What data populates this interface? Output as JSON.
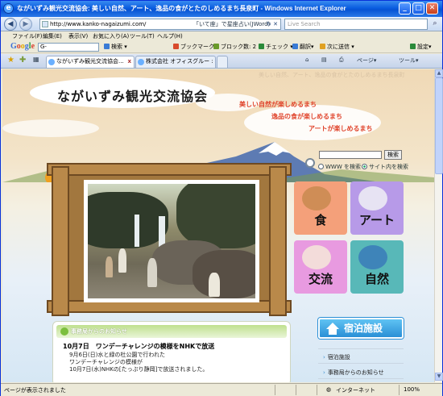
{
  "window": {
    "title": "ながいずみ観光交流協会: 美しい自然、アート、逸品の食がとたのしめるまち長泉町 - Windows Internet Explorer",
    "minimize": "_",
    "maximize": "□",
    "close": "✕"
  },
  "address": {
    "url": "http://www.kanko-nagaizumi.com/",
    "nav_hint": "↻ ✕",
    "search_placeholder": "Live Search",
    "highlight_text": "「いて座」で星座占い(JWord)"
  },
  "menu": [
    "ファイル(F)",
    "編集(E)",
    "表示(V)",
    "お気に入り(A)",
    "ツール(T)",
    "ヘルプ(H)"
  ],
  "google_toolbar": {
    "logo": "Google",
    "input_value": "G-",
    "items": [
      {
        "label": "検索 ▾",
        "color": "#3a7bd5"
      },
      {
        "label": "ブックマーク▾",
        "color": "#d84a2c"
      },
      {
        "label": "ブロック数: 2",
        "color": "#6a9a2a"
      },
      {
        "label": "チェック ▾",
        "color": "#2a8a3a"
      },
      {
        "label": "翻訳▾",
        "color": "#3a7bd5"
      },
      {
        "label": "次に送信 ▾",
        "color": "#e0a020"
      },
      {
        "label": "設定▾",
        "color": "#2a8a3a"
      }
    ]
  },
  "tabs": [
    {
      "label": "ながいずみ観光交流協会...",
      "active": true,
      "close": "x"
    },
    {
      "label": "株式会社 オフィスグルー : 静..."
    }
  ],
  "tab_tools": [
    "ページ▾",
    "ツール▾"
  ],
  "site": {
    "faint_tagline": "美しい自然、アート、逸品の食がとたのしめるまち長泉町",
    "title": "ながいずみ観光交流協会",
    "taglines": [
      "美しい自然が楽しめるまち",
      "逸品の食が楽しめるまち",
      "アートが楽しめるまち"
    ],
    "search_button": "検索",
    "radio_www": "WWW を検索",
    "radio_site": "サイト内を検索",
    "tiles": [
      {
        "label": "食",
        "color": "#f4a07a",
        "icon": "bread-icon"
      },
      {
        "label": "アート",
        "color": "#b79ae8",
        "icon": "palette-icon"
      },
      {
        "label": "交流",
        "color": "#e89ae0",
        "icon": "handshake-icon"
      },
      {
        "label": "自然",
        "color": "#58b8b8",
        "icon": "kingfisher-icon"
      }
    ],
    "news": {
      "header": "事務局からのお知らせ",
      "item_title": "10月7日　ワンデーチャレンジの模様をNHKで放送",
      "body_lines": [
        "9月6日(日)水と緑の杜公園で行われた",
        "ワンデーチャレンジの模様が",
        "10月7日(水)NHKの[たっぷり静岡]で放送されました。"
      ]
    },
    "lodging_button": "宿泊施設",
    "side_links": [
      "宿泊施設",
      "事務局からのお知らせ"
    ]
  },
  "status": {
    "text": "ページが表示されました",
    "zone": "インターネット",
    "zoom": "100%"
  }
}
